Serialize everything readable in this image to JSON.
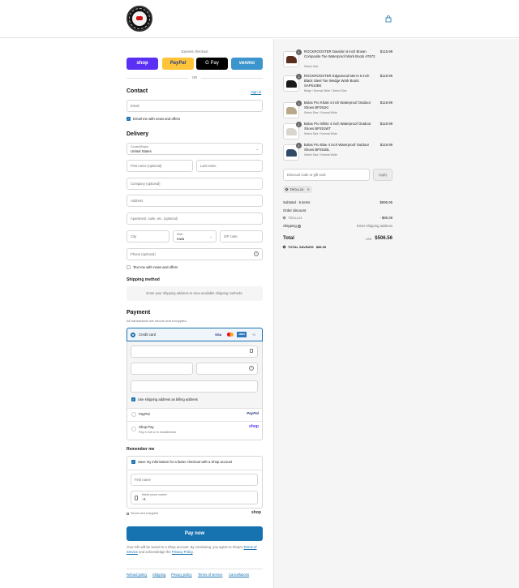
{
  "header": {
    "cart_icon": "bag-icon"
  },
  "express": {
    "title": "Express checkout",
    "shop_label": "shop",
    "paypal_label": "PayPal",
    "gpay_label": "G Pay",
    "venmo_label": "venmo",
    "or_label": "OR"
  },
  "contact": {
    "title": "Contact",
    "sign_in": "Sign in",
    "email_placeholder": "Email",
    "news_label": "Email me with news and offers"
  },
  "delivery": {
    "title": "Delivery",
    "country_label": "Country/Region",
    "country_value": "United States",
    "first_name": "First name (optional)",
    "last_name": "Last name",
    "company": "Company (optional)",
    "address": "Address",
    "apartment": "Apartment, suite, etc. (optional)",
    "city": "City",
    "state_label": "State",
    "state_value": "Iowa",
    "zip": "ZIP code",
    "phone": "Phone (optional)",
    "text_label": "Text me with news and offers"
  },
  "shipping": {
    "title": "Shipping method",
    "note": "Enter your shipping address to view available shipping methods."
  },
  "payment": {
    "title": "Payment",
    "subtitle": "All transactions are secure and encrypted.",
    "credit_card": "Credit card",
    "visa": "VISA",
    "amex": "AMEX",
    "more": "+1",
    "billing_label": "Use shipping address as billing address",
    "paypal": "PayPal",
    "paypal_logo": "PayPal",
    "shop_pay": "Shop Pay",
    "shop_pay_sub": "Pay in full or in installments",
    "shop_logo": "shop"
  },
  "remember": {
    "title": "Remember me",
    "save_label": "Save my information for a faster checkout with a Shop account",
    "first_name": "First name",
    "mobile_label": "Mobile phone number",
    "mobile_value": "+1",
    "secure": "Secure and encrypted",
    "shop_logo": "shop"
  },
  "pay_now": "Pay now",
  "legal": {
    "text": "Your info will be saved to a Shop account. By continuing, you agree to Shop's",
    "terms": "Terms of Service",
    "and": "and acknowledge the",
    "privacy": "Privacy Policy",
    "period": "."
  },
  "footer_links": [
    "Refund policy",
    "Shipping",
    "Privacy policy",
    "Terms of service",
    "Cancellations"
  ],
  "cart": {
    "items": [
      {
        "qty": "1",
        "name": "ROCKROOSTER Davidon 6 inch Brown Composite Toe Waterproof Work Boots AT672",
        "variant": "Select Size",
        "price": "$115.99",
        "color": "#5a2e1e"
      },
      {
        "qty": "1",
        "name": "ROCKROOSTER Edgewood Men's 6 inch Black Steel Toe Wedge Work Boots SAP610BK",
        "variant": "Beige / Normal Wide / Select Size",
        "price": "$119.99",
        "color": "#1a1a1a"
      },
      {
        "qty": "1",
        "name": "Bolas Pro Khaki 4 inch Waterproof Outdoor Shoes BP251KI",
        "variant": "Select Size / Normal Wide",
        "price": "$119.99",
        "color": "#b8a98a"
      },
      {
        "qty": "1",
        "name": "Bolas Pro White 4 inch Waterproof Outdoor Shoes BP251WT",
        "variant": "Select Size / Normal Wide",
        "price": "$119.99",
        "color": "#d9d6cf"
      },
      {
        "qty": "1",
        "name": "Bolas Pro Blue 4 inch Waterproof Outdoor Shoes BP251BL",
        "variant": "Select Size / Normal Wide",
        "price": "$119.99",
        "color": "#2e4a66"
      }
    ],
    "discount_placeholder": "Discount code or gift card",
    "apply": "Apply",
    "code_chip": "TROLL24",
    "subtotal_label": "Subtotal · 5 items",
    "subtotal": "$595.95",
    "order_discount": "Order discount",
    "discount_code": "TROLL24",
    "discount_value": "- $89.39",
    "shipping_label": "Shipping",
    "shipping_value": "Enter shipping address",
    "total_label": "Total",
    "currency": "USD",
    "total": "$506.56",
    "savings_label": "TOTAL SAVINGS",
    "savings": "$89.39"
  }
}
